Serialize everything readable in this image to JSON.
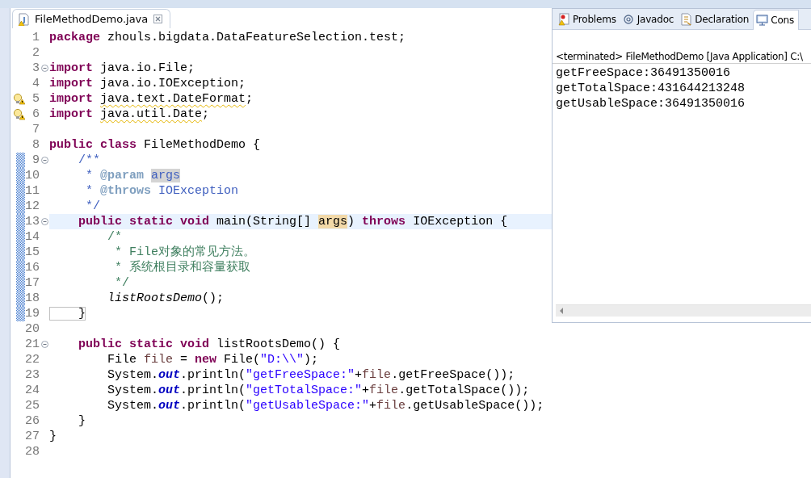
{
  "editor": {
    "tab": {
      "title": "FileMethodDemo.java",
      "selected": true
    },
    "lines": [
      {
        "number": "1",
        "fold": false,
        "warning": false,
        "in_range": false,
        "current": false,
        "tokens": [
          {
            "kind": "keyword",
            "text": "package"
          },
          {
            "kind": "plain",
            "text": " zhouls.bigdata.DataFeatureSelection.test;"
          }
        ]
      },
      {
        "number": "2",
        "fold": false,
        "warning": false,
        "in_range": false,
        "current": false
      },
      {
        "number": "3",
        "fold": true,
        "warning": false,
        "in_range": false,
        "current": false,
        "tokens": [
          {
            "kind": "keyword",
            "text": "import"
          },
          {
            "kind": "plain",
            "text": " java.io.File;"
          }
        ]
      },
      {
        "number": "4",
        "fold": false,
        "warning": false,
        "in_range": false,
        "current": false,
        "tokens": [
          {
            "kind": "keyword",
            "text": "import"
          },
          {
            "kind": "plain",
            "text": " java.io.IOException;"
          }
        ]
      },
      {
        "number": "5",
        "fold": false,
        "warning": true,
        "in_range": false,
        "current": false,
        "tokens": [
          {
            "kind": "keyword",
            "text": "import "
          },
          {
            "kind": "warning",
            "text": "java.text.DateFormat"
          },
          {
            "kind": "plain",
            "text": ";"
          }
        ]
      },
      {
        "number": "6",
        "fold": false,
        "warning": true,
        "in_range": false,
        "current": false,
        "tokens": [
          {
            "kind": "keyword",
            "text": "import "
          },
          {
            "kind": "warning",
            "text": "java.util.Date"
          },
          {
            "kind": "plain",
            "text": ";"
          }
        ]
      },
      {
        "number": "7",
        "fold": false,
        "warning": false,
        "in_range": false,
        "current": false
      },
      {
        "number": "8",
        "fold": false,
        "warning": false,
        "in_range": false,
        "current": false,
        "tokens": [
          {
            "kind": "keyword",
            "text": "public class"
          },
          {
            "kind": "plain",
            "text": " FileMethodDemo {"
          }
        ]
      },
      {
        "number": "9",
        "fold": true,
        "warning": false,
        "in_range": true,
        "current": false,
        "tokens": [
          {
            "kind": "javadoc",
            "text": "    /**"
          }
        ]
      },
      {
        "number": "10",
        "fold": false,
        "warning": false,
        "in_range": true,
        "current": false,
        "tokens": [
          {
            "kind": "javadoc",
            "text": "     * "
          },
          {
            "kind": "javadoc-tag",
            "text": "@param "
          },
          {
            "kind": "javadoc-occurrence",
            "text": "args"
          }
        ]
      },
      {
        "number": "11",
        "fold": false,
        "warning": false,
        "in_range": true,
        "current": false,
        "tokens": [
          {
            "kind": "javadoc",
            "text": "     * "
          },
          {
            "kind": "javadoc-tag",
            "text": "@throws"
          },
          {
            "kind": "javadoc",
            "text": " IOException"
          }
        ]
      },
      {
        "number": "12",
        "fold": false,
        "warning": false,
        "in_range": true,
        "current": false,
        "tokens": [
          {
            "kind": "javadoc",
            "text": "     */"
          }
        ]
      },
      {
        "number": "13",
        "fold": true,
        "warning": false,
        "in_range": true,
        "current": true,
        "tokens": [
          {
            "kind": "keyword",
            "text": "    public static void"
          },
          {
            "kind": "plain",
            "text": " main(String[] "
          },
          {
            "kind": "occurrence",
            "text": "args"
          },
          {
            "kind": "plain",
            "text": ") "
          },
          {
            "kind": "keyword",
            "text": "throws"
          },
          {
            "kind": "plain",
            "text": " IOException {"
          }
        ]
      },
      {
        "number": "14",
        "fold": false,
        "warning": false,
        "in_range": true,
        "current": false,
        "tokens": [
          {
            "kind": "comment",
            "text": "        /*"
          }
        ]
      },
      {
        "number": "15",
        "fold": false,
        "warning": false,
        "in_range": true,
        "current": false,
        "tokens": [
          {
            "kind": "comment",
            "text": "         * File对象的常见方法。"
          }
        ]
      },
      {
        "number": "16",
        "fold": false,
        "warning": false,
        "in_range": true,
        "current": false,
        "tokens": [
          {
            "kind": "comment",
            "text": "         * 系统根目录和容量获取"
          }
        ]
      },
      {
        "number": "17",
        "fold": false,
        "warning": false,
        "in_range": true,
        "current": false,
        "tokens": [
          {
            "kind": "comment",
            "text": "         */"
          }
        ]
      },
      {
        "number": "18",
        "fold": false,
        "warning": false,
        "in_range": true,
        "current": false,
        "tokens": [
          {
            "kind": "static-method",
            "text": "        listRootsDemo"
          },
          {
            "kind": "plain",
            "text": "();"
          }
        ]
      },
      {
        "number": "19",
        "fold": false,
        "warning": false,
        "in_range": true,
        "current": false,
        "tokens": [
          {
            "kind": "bracket-match",
            "text": "    }"
          }
        ]
      },
      {
        "number": "20",
        "fold": false,
        "warning": false,
        "in_range": false,
        "current": false
      },
      {
        "number": "21",
        "fold": true,
        "warning": false,
        "in_range": false,
        "current": false,
        "tokens": [
          {
            "kind": "keyword",
            "text": "    public static void"
          },
          {
            "kind": "plain",
            "text": " listRootsDemo() {"
          }
        ]
      },
      {
        "number": "22",
        "fold": false,
        "warning": false,
        "in_range": false,
        "current": false,
        "tokens": [
          {
            "kind": "plain",
            "text": "        File "
          },
          {
            "kind": "local",
            "text": "file"
          },
          {
            "kind": "plain",
            "text": " = "
          },
          {
            "kind": "keyword",
            "text": "new"
          },
          {
            "kind": "plain",
            "text": " File("
          },
          {
            "kind": "string",
            "text": "\"D:\\\\\""
          },
          {
            "kind": "plain",
            "text": ");"
          }
        ]
      },
      {
        "number": "23",
        "fold": false,
        "warning": false,
        "in_range": false,
        "current": false,
        "tokens": [
          {
            "kind": "plain",
            "text": "        System."
          },
          {
            "kind": "static-field",
            "text": "out"
          },
          {
            "kind": "plain",
            "text": ".println("
          },
          {
            "kind": "string",
            "text": "\"getFreeSpace:\""
          },
          {
            "kind": "plain",
            "text": "+"
          },
          {
            "kind": "local",
            "text": "file"
          },
          {
            "kind": "plain",
            "text": ".getFreeSpace());"
          }
        ]
      },
      {
        "number": "24",
        "fold": false,
        "warning": false,
        "in_range": false,
        "current": false,
        "tokens": [
          {
            "kind": "plain",
            "text": "        System."
          },
          {
            "kind": "static-field",
            "text": "out"
          },
          {
            "kind": "plain",
            "text": ".println("
          },
          {
            "kind": "string",
            "text": "\"getTotalSpace:\""
          },
          {
            "kind": "plain",
            "text": "+"
          },
          {
            "kind": "local",
            "text": "file"
          },
          {
            "kind": "plain",
            "text": ".getTotalSpace());"
          }
        ]
      },
      {
        "number": "25",
        "fold": false,
        "warning": false,
        "in_range": false,
        "current": false,
        "tokens": [
          {
            "kind": "plain",
            "text": "        System."
          },
          {
            "kind": "static-field",
            "text": "out"
          },
          {
            "kind": "plain",
            "text": ".println("
          },
          {
            "kind": "string",
            "text": "\"getUsableSpace:\""
          },
          {
            "kind": "plain",
            "text": "+"
          },
          {
            "kind": "local",
            "text": "file"
          },
          {
            "kind": "plain",
            "text": ".getUsableSpace());"
          }
        ]
      },
      {
        "number": "26",
        "fold": false,
        "warning": false,
        "in_range": false,
        "current": false,
        "tokens": [
          {
            "kind": "plain",
            "text": "    }"
          }
        ]
      },
      {
        "number": "27",
        "fold": false,
        "warning": false,
        "in_range": false,
        "current": false,
        "tokens": [
          {
            "kind": "plain",
            "text": "}"
          }
        ]
      },
      {
        "number": "28",
        "fold": false,
        "warning": false,
        "in_range": false,
        "current": false
      }
    ]
  },
  "console": {
    "tabs": [
      {
        "label": "Problems",
        "selected": false
      },
      {
        "label": "Javadoc",
        "selected": false
      },
      {
        "label": "Declaration",
        "selected": false
      },
      {
        "label": "Cons",
        "selected": true
      }
    ],
    "header": "<terminated> FileMethodDemo [Java Application] C:\\",
    "output": [
      "getFreeSpace:36491350016",
      "getTotalSpace:431644213248",
      "getUsableSpace:36491350016"
    ]
  }
}
